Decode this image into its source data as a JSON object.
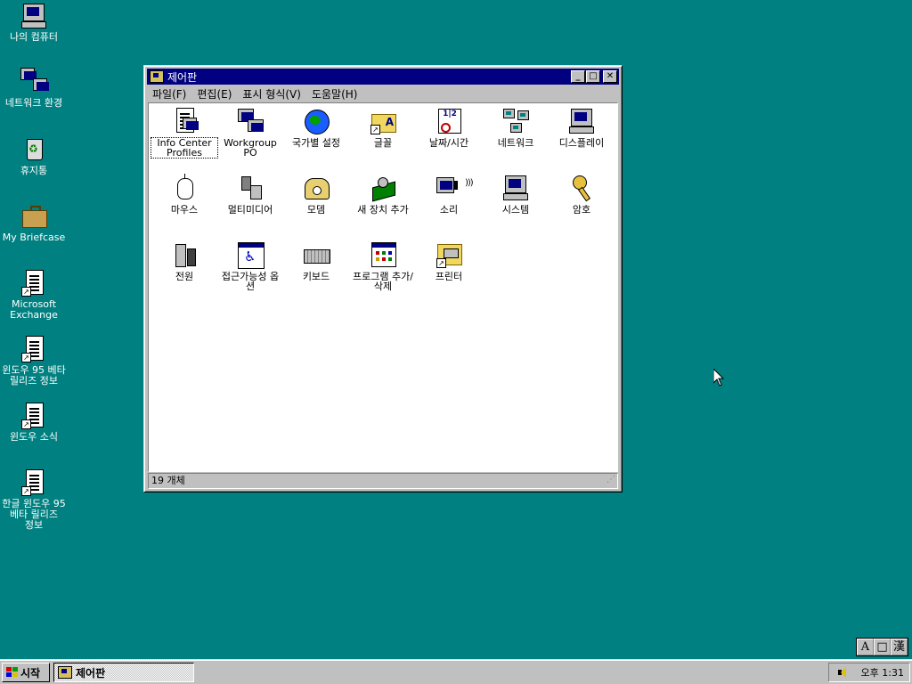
{
  "desktop": {
    "icons": [
      {
        "label": "나의 컴퓨터"
      },
      {
        "label": "네트워크 환경"
      },
      {
        "label": "휴지통"
      },
      {
        "label": "My Briefcase"
      },
      {
        "label": "Microsoft Exchange"
      },
      {
        "label": "윈도우 95 베타 릴리즈 정보"
      },
      {
        "label": "윈도우 소식"
      },
      {
        "label": "한글 윈도우 95 베타 릴리즈 정보"
      }
    ]
  },
  "window": {
    "title": "제어판",
    "menu": [
      "파일(F)",
      "편집(E)",
      "표시 형식(V)",
      "도움말(H)"
    ],
    "items": [
      {
        "label": "Info Center Profiles",
        "icon": "info-center-icon"
      },
      {
        "label": "Workgroup PO",
        "icon": "workgroup-icon"
      },
      {
        "label": "국가별 설정",
        "icon": "globe-icon"
      },
      {
        "label": "글꼴",
        "icon": "fonts-folder-icon"
      },
      {
        "label": "날짜/시간",
        "icon": "calendar-clock-icon"
      },
      {
        "label": "네트워크",
        "icon": "network-icon"
      },
      {
        "label": "디스플레이",
        "icon": "display-icon"
      },
      {
        "label": "마우스",
        "icon": "mouse-icon"
      },
      {
        "label": "멀티미디어",
        "icon": "multimedia-icon"
      },
      {
        "label": "모뎀",
        "icon": "modem-icon"
      },
      {
        "label": "새 장치 추가",
        "icon": "add-hardware-icon"
      },
      {
        "label": "소리",
        "icon": "sound-icon"
      },
      {
        "label": "시스템",
        "icon": "system-icon"
      },
      {
        "label": "암호",
        "icon": "keys-icon"
      },
      {
        "label": "전원",
        "icon": "power-icon"
      },
      {
        "label": "접근가능성 옵션",
        "icon": "accessibility-icon"
      },
      {
        "label": "키보드",
        "icon": "keyboard-icon"
      },
      {
        "label": "프로그램 추가/삭제",
        "icon": "add-remove-programs-icon"
      },
      {
        "label": "프린터",
        "icon": "printers-folder-icon"
      }
    ],
    "status": "19 개체"
  },
  "ime": [
    "A",
    "□",
    "漢"
  ],
  "taskbar": {
    "start_label": "시작",
    "task_label": "제어판",
    "clock": "오후 1:31"
  }
}
